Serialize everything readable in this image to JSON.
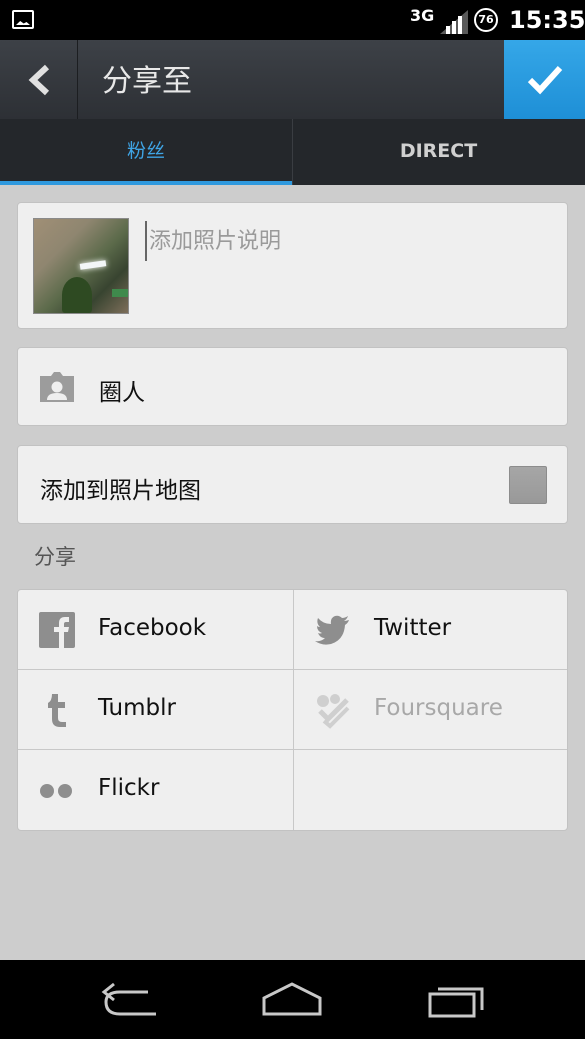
{
  "status_bar": {
    "network": "3G",
    "battery": "76",
    "time": "15:35"
  },
  "action_bar": {
    "title": "分享至",
    "icons": {
      "back": "chevron-left-icon",
      "confirm": "checkmark-icon"
    },
    "confirm_color": "#1e8fd6"
  },
  "tabs": [
    {
      "label": "粉丝",
      "active": true
    },
    {
      "label": "DIRECT",
      "active": false
    }
  ],
  "caption": {
    "placeholder": "添加照片说明",
    "value": ""
  },
  "tag_people": {
    "label": "圈人",
    "icon": "person-tag-icon"
  },
  "photo_map": {
    "label": "添加到照片地图",
    "checked": false
  },
  "share": {
    "section_label": "分享",
    "services": [
      {
        "label": "Facebook",
        "icon": "facebook-icon",
        "enabled": true
      },
      {
        "label": "Twitter",
        "icon": "twitter-icon",
        "enabled": true
      },
      {
        "label": "Tumblr",
        "icon": "tumblr-icon",
        "enabled": true
      },
      {
        "label": "Foursquare",
        "icon": "foursquare-icon",
        "enabled": false
      },
      {
        "label": "Flickr",
        "icon": "flickr-icon",
        "enabled": true
      }
    ]
  },
  "accent_color": "#2f99de"
}
